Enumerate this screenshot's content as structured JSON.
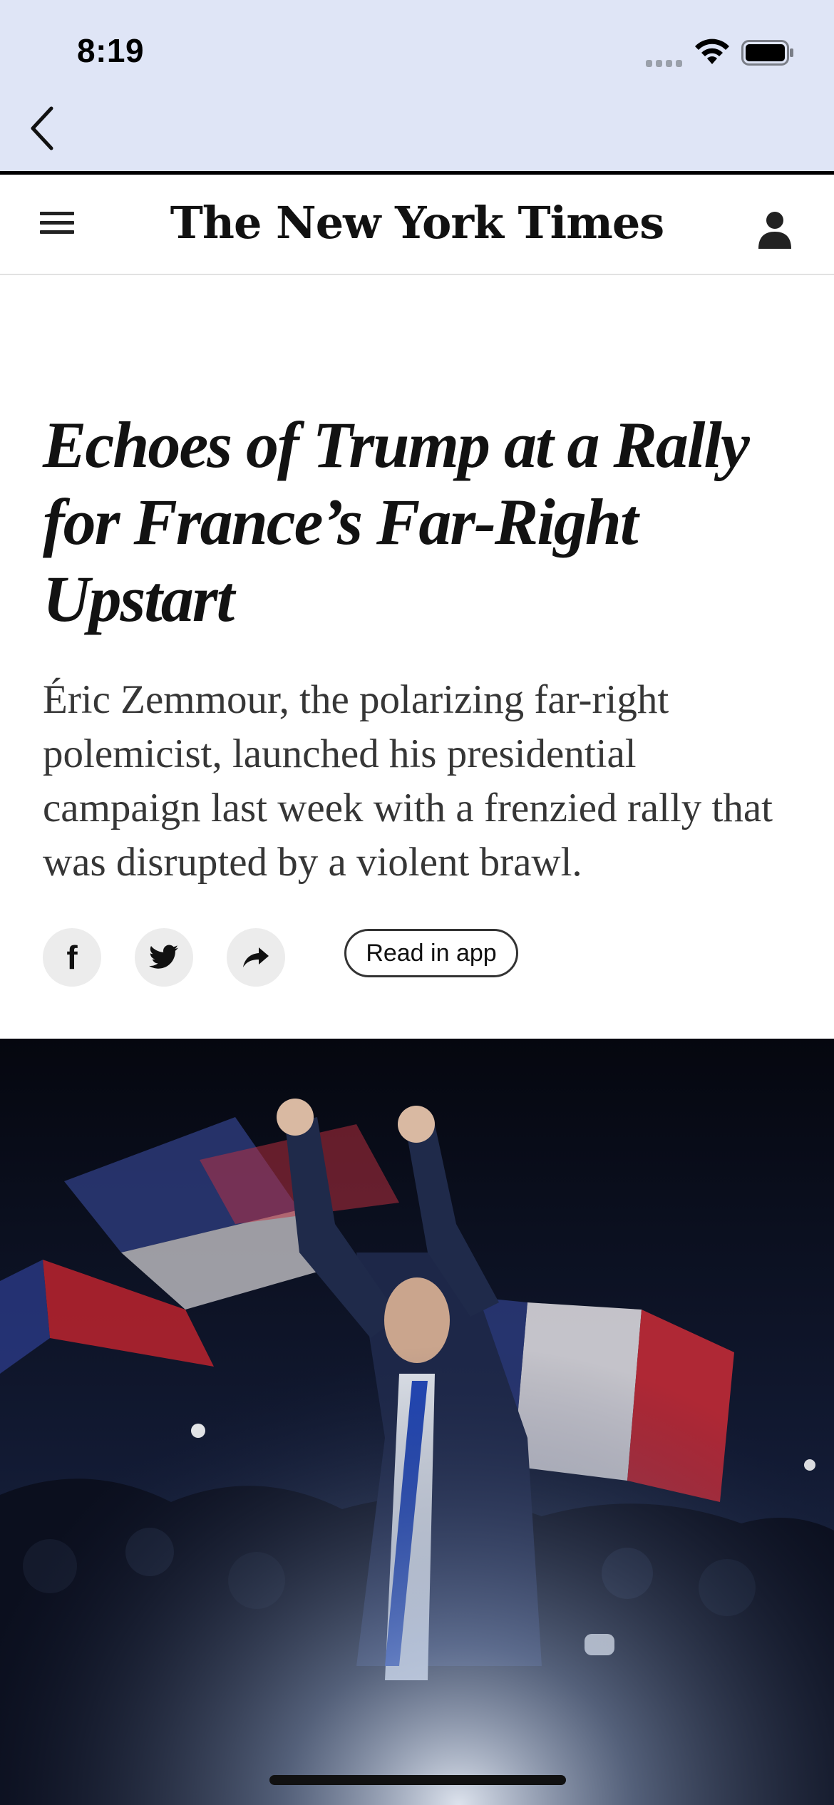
{
  "status_bar": {
    "time": "8:19"
  },
  "nav": {
    "back_icon": "chevron-left-icon"
  },
  "header": {
    "masthead": "The New York Times",
    "menu_icon": "hamburger-menu-icon",
    "account_icon": "person-icon"
  },
  "article": {
    "headline": "Echoes of Trump at a Rally for France’s Far-Right Upstart",
    "summary": "Éric Zemmour, the polarizing far-right polemicist, launched his presidential campaign last week with a frenzied rally that was disrupted by a violent brawl.",
    "share": {
      "facebook_glyph": "f",
      "read_in_app_label": "Read in app"
    }
  },
  "colors": {
    "status_bar_bg": "#dfe5f6",
    "header_rule": "#000000",
    "button_bg": "#ececec"
  }
}
